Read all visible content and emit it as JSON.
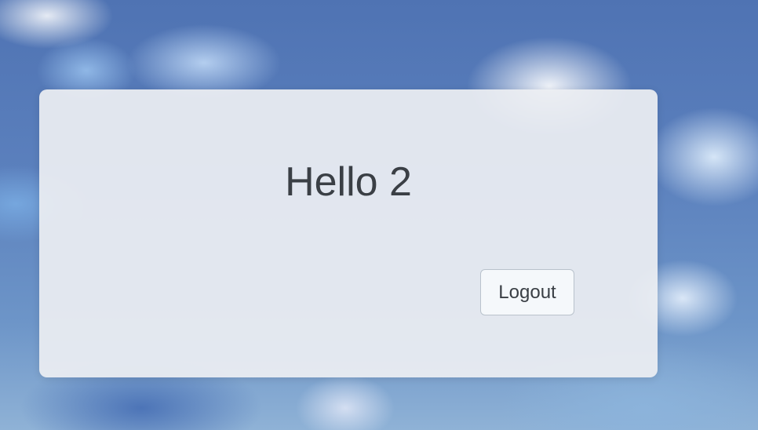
{
  "card": {
    "title": "Hello 2",
    "logout_label": "Logout"
  },
  "colors": {
    "card_background": "#eceef2",
    "text": "#3a3f45",
    "button_border": "#b9c2cc",
    "sky": "#5b80bd"
  }
}
